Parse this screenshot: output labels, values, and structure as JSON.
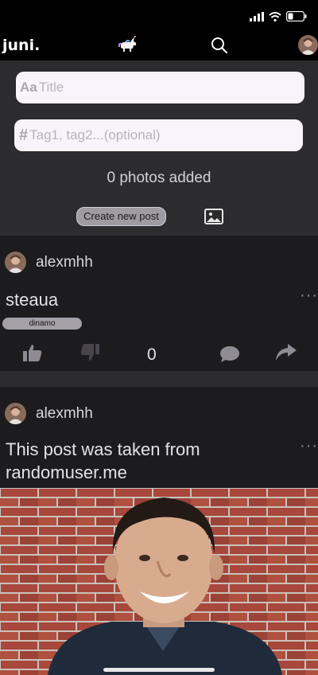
{
  "app": {
    "brand": "juni."
  },
  "status_bar": {
    "icons": [
      "cellular-signal-icon",
      "wifi-icon",
      "battery-icon"
    ]
  },
  "nav": {
    "icons": [
      "unicorn-logo-icon",
      "search-icon",
      "profile-avatar"
    ]
  },
  "composer": {
    "title_prefix": "Aa",
    "title_placeholder": "Title",
    "tags_prefix": "#",
    "tags_placeholder": "Tag1, tag2...(optional)",
    "photos_count": "0 photos added",
    "create_label": "Create new post",
    "image_icon": "image-icon"
  },
  "posts": [
    {
      "author": "alexmhh",
      "more": "···",
      "text": "steaua",
      "tag": "dinamo",
      "likes": "0",
      "icons": [
        "thumbs-up-icon",
        "thumbs-down-icon",
        "comment-icon",
        "share-icon"
      ]
    },
    {
      "author": "alexmhh",
      "more": "···",
      "text_line1": "This post was taken from",
      "text_line2": "randomuser.me"
    }
  ],
  "colors": {
    "background": "#1c1c1e",
    "composer": "#2c2c2e",
    "bar": "#000000",
    "field": "#f7f5fb"
  }
}
